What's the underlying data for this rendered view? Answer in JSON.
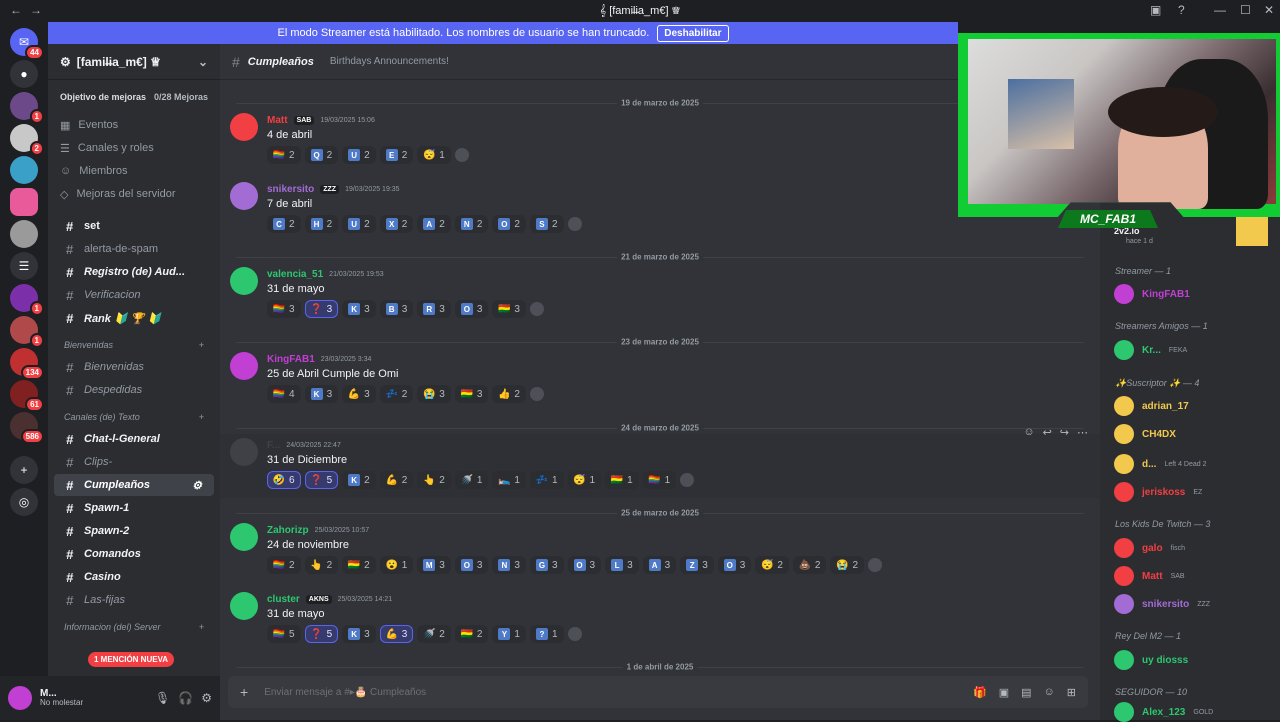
{
  "window": {
    "title": "𝄞 [famil̶ia_m€] ♕",
    "back": "←",
    "forward": "→",
    "minimize": "—",
    "maximize": "☐",
    "close": "✕"
  },
  "streamer_bar": {
    "text": "El modo Streamer está habilitado. Los nombres de usuario se han truncado.",
    "button": "Deshabilitar"
  },
  "guilds": {
    "badges": [
      "44",
      "1",
      "2",
      "1",
      "1",
      "134",
      "61",
      "586"
    ]
  },
  "server": {
    "name": "[famil̶ia_m€] ♕",
    "boost": {
      "label": "Objetivo de mejoras",
      "progress": "0/28 Mejoras"
    },
    "nav": [
      "Eventos",
      "Canales y roles",
      "Miembros",
      "Mejoras del servidor"
    ],
    "channels_top": [
      "set",
      "alerta-de-spam",
      "Registro (de) Aud...",
      "Verificacion",
      "Rank 🔰 🏆 🔰"
    ],
    "cat_bienvenidas": "Bienvenidas",
    "channels_bienvenidas": [
      "Bienvenidas",
      "Despedidas"
    ],
    "cat_canales": "Canales (de) Texto",
    "channels_texto": [
      "Chat-l-General",
      "Clips-",
      "Cumpleaños",
      "Spawn-1",
      "Spawn-2",
      "Comandos",
      "Casino",
      "Las-fijas"
    ],
    "cat_info": "Informacion (del) Server",
    "mention": "1 MENCIÓN NUEVA"
  },
  "user": {
    "name": "M...",
    "status": "No molestar"
  },
  "channel": {
    "name": "Cumpleaños",
    "topic": "Birthdays Announcements!",
    "input_placeholder": "Enviar mensaje a #▸🎂 Cumpleaños"
  },
  "dividers": [
    "19 de marzo de 2025",
    "21 de marzo de 2025",
    "23 de marzo de 2025",
    "24 de marzo de 2025",
    "25 de marzo de 2025",
    "1 de abril de 2025"
  ],
  "messages": [
    {
      "author": "Matt",
      "tag": "SAB",
      "time": "19/03/2025 15:06",
      "content": "4 de abril",
      "color": "#f23f43",
      "reactions": [
        [
          "🏳️‍🌈",
          "2"
        ],
        [
          "Q",
          "2"
        ],
        [
          "U",
          "2"
        ],
        [
          "E",
          "2"
        ],
        [
          "😴",
          "1"
        ]
      ]
    },
    {
      "author": "snikersito",
      "tag": "ZZZ",
      "time": "19/03/2025 19:35",
      "content": "7 de abril",
      "color": "#a36cd4",
      "reactions": [
        [
          "C",
          "2"
        ],
        [
          "H",
          "2"
        ],
        [
          "U",
          "2"
        ],
        [
          "X",
          "2"
        ],
        [
          "A",
          "2"
        ],
        [
          "N",
          "2"
        ],
        [
          "O",
          "2"
        ],
        [
          "S",
          "2"
        ]
      ]
    },
    {
      "author": "valencia_51",
      "tag": "",
      "time": "21/03/2025 19:53",
      "content": "31 de mayo",
      "color": "#2dc770",
      "reactions": [
        [
          "🏳️‍🌈",
          "3"
        ],
        [
          "❓",
          "3"
        ],
        [
          "K",
          "3"
        ],
        [
          "B",
          "3"
        ],
        [
          "R",
          "3"
        ],
        [
          "O",
          "3"
        ],
        [
          "🇧🇴",
          "3"
        ]
      ]
    },
    {
      "author": "KingFAB1",
      "tag": "",
      "time": "23/03/2025 3:34",
      "content": "25 de Abril Cumple de Omi",
      "color": "#c23fd4",
      "reactions": [
        [
          "🏳️‍🌈",
          "4"
        ],
        [
          "K",
          "3"
        ],
        [
          "💪",
          "3"
        ],
        [
          "💤",
          "2"
        ],
        [
          "😭",
          "3"
        ],
        [
          "🇧🇴",
          "3"
        ],
        [
          "👍",
          "2"
        ]
      ]
    },
    {
      "author": "F...",
      "tag": "",
      "time": "24/03/2025 22:47",
      "content": "31 de Diciembre",
      "color": "#3f4147",
      "reactions": [
        [
          "🤣",
          "6"
        ],
        [
          "❓",
          "5"
        ],
        [
          "K",
          "2"
        ],
        [
          "💪",
          "2"
        ],
        [
          "👆",
          "2"
        ],
        [
          "🚿",
          "1"
        ],
        [
          "🛌",
          "1"
        ],
        [
          "💤",
          "1"
        ],
        [
          "😴",
          "1"
        ],
        [
          "🇧🇴",
          "1"
        ],
        [
          "🏳️‍🌈",
          "1"
        ]
      ]
    },
    {
      "author": "Zahorizp",
      "tag": "",
      "time": "25/03/2025 10:57",
      "content": "24 de noviembre",
      "color": "#2dc770",
      "reactions": [
        [
          "🏳️‍🌈",
          "2"
        ],
        [
          "👆",
          "2"
        ],
        [
          "🇧🇴",
          "2"
        ],
        [
          "😮",
          "1"
        ],
        [
          "M",
          "3"
        ],
        [
          "O",
          "3"
        ],
        [
          "N",
          "3"
        ],
        [
          "G",
          "3"
        ],
        [
          "O",
          "3"
        ],
        [
          "L",
          "3"
        ],
        [
          "A",
          "3"
        ],
        [
          "Z",
          "3"
        ],
        [
          "O",
          "3"
        ],
        [
          "😴",
          "2"
        ],
        [
          "💩",
          "2"
        ],
        [
          "😭",
          "2"
        ]
      ]
    },
    {
      "author": "cluster",
      "tag": "AKNS",
      "time": "25/03/2025 14:21",
      "content": "31 de mayo",
      "color": "#2dc770",
      "reactions": [
        [
          "🏳️‍🌈",
          "5"
        ],
        [
          "❓",
          "5"
        ],
        [
          "K",
          "3"
        ],
        [
          "💪",
          "3"
        ],
        [
          "🚿",
          "2"
        ],
        [
          "🇧🇴",
          "2"
        ],
        [
          "Y",
          "1"
        ],
        [
          "?",
          "1"
        ]
      ]
    }
  ],
  "members": {
    "stream_title": "2v2.io",
    "stream_sub": "hace 1 d",
    "categories": [
      {
        "label": "Streamer — 1"
      },
      {
        "label": "Streamers Amigos — 1"
      },
      {
        "label": "✨Suscriptor ✨ — 4"
      },
      {
        "label": "Los Kids De Twitch — 3"
      },
      {
        "label": "Rey Del M2 — 1"
      },
      {
        "label": "SEGUIDOR — 10"
      }
    ],
    "list": [
      {
        "name": "KingFAB1",
        "color": "#c23fd4",
        "sub": ""
      },
      {
        "name": "Kr...",
        "color": "#2dc770",
        "sub": "FEKA"
      },
      {
        "name": "adrian_17",
        "color": "#f2c94c",
        "sub": ""
      },
      {
        "name": "CH4DX",
        "color": "#f2c94c",
        "sub": ""
      },
      {
        "name": "d...",
        "color": "#f2c94c",
        "sub": "Left 4 Dead 2"
      },
      {
        "name": "jeriskoss",
        "color": "#f23f43",
        "sub": "EZ"
      },
      {
        "name": "galo",
        "color": "#f23f43",
        "sub": "fisch"
      },
      {
        "name": "Matt",
        "color": "#f23f43",
        "sub": "SAB"
      },
      {
        "name": "snikersito",
        "color": "#a36cd4",
        "sub": "ZZZ"
      },
      {
        "name": "uy diosss",
        "color": "#2dc770",
        "sub": ""
      },
      {
        "name": "Alex_123",
        "color": "#2dc770",
        "sub": "GOLD"
      }
    ]
  },
  "webcam": {
    "label": "MC_FAB1"
  }
}
